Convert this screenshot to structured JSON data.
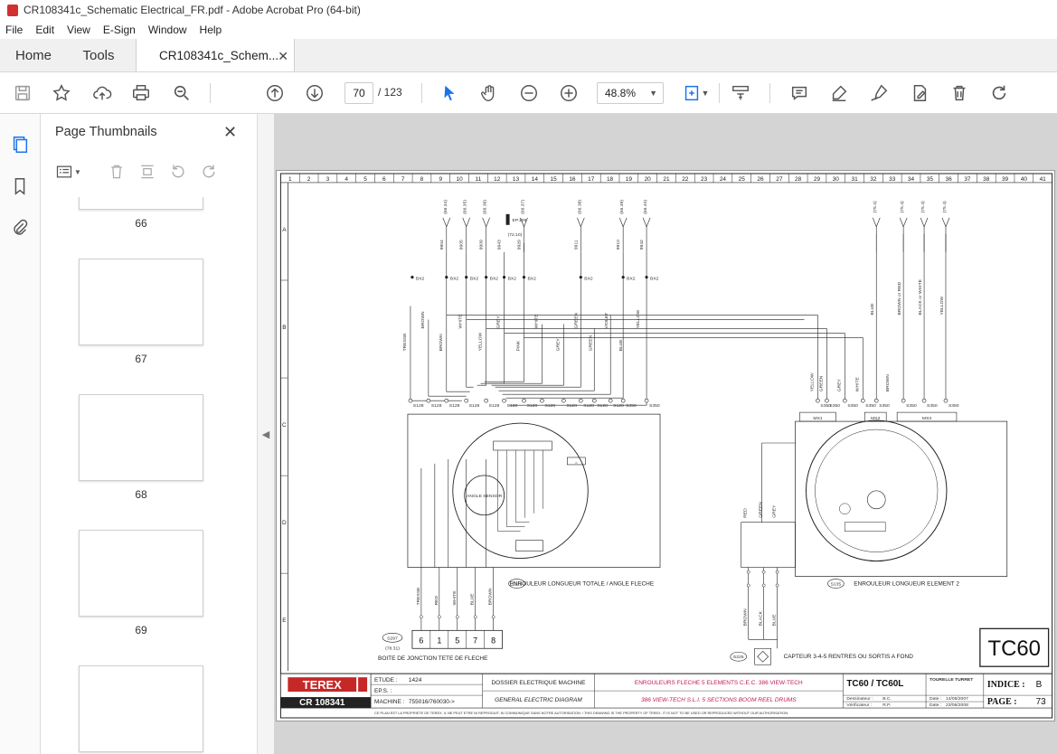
{
  "window": {
    "title": "CR108341c_Schematic Electrical_FR.pdf - Adobe Acrobat Pro (64-bit)"
  },
  "menu": [
    "File",
    "Edit",
    "View",
    "E-Sign",
    "Window",
    "Help"
  ],
  "tabs": {
    "home": "Home",
    "tools": "Tools",
    "document": "CR108341c_Schem..."
  },
  "toolbar": {
    "page_current": "70",
    "page_total": "/ 123",
    "zoom": "48.8%"
  },
  "thumbnails": {
    "title": "Page Thumbnails",
    "pages": [
      "66",
      "67",
      "68",
      "69"
    ]
  },
  "schematic": {
    "columns": [
      "1",
      "2",
      "3",
      "4",
      "5",
      "6",
      "7",
      "8",
      "9",
      "10",
      "11",
      "12",
      "13",
      "14",
      "15",
      "16",
      "17",
      "18",
      "19",
      "20",
      "21",
      "22",
      "23",
      "24",
      "25",
      "26",
      "27",
      "28",
      "29",
      "30",
      "31",
      "32",
      "33",
      "34",
      "35",
      "36",
      "37",
      "38",
      "39",
      "40",
      "41"
    ],
    "rows": [
      "A",
      "B",
      "C",
      "D",
      "E"
    ],
    "refs_top": [
      "(66.34)",
      "(66.35)",
      "(66.36)",
      "(66.37)",
      "(66.38)",
      "(66.39)",
      "(66.40)",
      "(75.4)",
      "(75.4)",
      "(75.4)",
      "(75.4)"
    ],
    "wire_numbers": [
      "9904",
      "9905",
      "9909",
      "9943",
      "9929",
      "9911",
      "9910",
      "9942"
    ],
    "connector_top": "BX2",
    "colors_left": [
      "TRESSE",
      "BROWN",
      "BROWN",
      "WHITE",
      "YELLOW",
      "GREY",
      "PINK",
      "WHITE",
      "GREY",
      "GREEN",
      "GREEN",
      "VIOLET",
      "BLUE",
      "YELLOW"
    ],
    "colors_right": [
      "YELLOW",
      "GREEN",
      "GREY",
      "WHITE",
      "BROWN",
      "BLUE",
      "BROWN or RED",
      "BLACK or WHITE",
      "YELLOW"
    ],
    "connector_s128": "S128",
    "connector_s350": "S350",
    "ms_labels": [
      "MS1",
      "MS2",
      "MS3"
    ],
    "angle_sensor": "ANGLE SENSOR",
    "reel1_caption": "ENROULEUR LONGUEUR TOTALE / ANGLE FLECHE",
    "reel1_ref": "S129",
    "reel2_caption": "ENROULEUR LONGUEUR ELEMENT 2",
    "reel2_ref": "S135",
    "capteur_caption": "CAPTEUR 3-4-5 RENTRES OU SORTIS A FOND",
    "capteur_ref": "S225",
    "boite_caption": "BOITE DE JONCTION TETE DE FLECHE",
    "boite_ref": "S297",
    "boite_sub": "(78.31)",
    "boite_terms": [
      "6",
      "1",
      "5",
      "7",
      "8"
    ],
    "boite_colors": [
      "TRESSE",
      "RED",
      "WHITE",
      "BLUE",
      "BROWN"
    ],
    "p900_colors_top": [
      "RED",
      "GREEN",
      "GREY"
    ],
    "p900_colors_bot": [
      "BROWN",
      "BLACK",
      "BLUE"
    ],
    "model_box": "TC60",
    "ep_ref": "EP.109",
    "ep_sub": "(72.10)",
    "title_block": {
      "brand": "TEREX",
      "doc_number": "CR 108341",
      "etude_label": "ETUDE :",
      "etude_value": "1424",
      "eps_label": "EP.S. :",
      "machine_label": "MACHINE :",
      "machine_value": "755016/760030->",
      "doc_fr": "DOSSIER ELECTRIQUE MACHINE",
      "doc_en": "GENERAL ELECTRIC DIAGRAM",
      "title_fr": "ENROULEURS FLECHE 5 ELEMENTS C.E.C. 386 VIEW-TECH",
      "title_en": "386 VIEW-TECH S.L.I. 5 SECTIONS BOOM REEL DRUMS",
      "model": "TC60 / TC60L",
      "section": "TOURELLE TURRET",
      "dessinateur_label": "Dessinateur :",
      "dessinateur_value": "B.C.",
      "verificateur_label": "Vérificateur :",
      "verificateur_value": "R.P.",
      "date_label": "Date :",
      "date1": "14/05/2007",
      "date2": "23/06/2008",
      "indice_label": "INDICE :",
      "indice_value": "B",
      "page_label": "PAGE :",
      "page_value": "73",
      "legal": "CE PLAN EST LA PROPRIETE DE TEREX. IL NE PEUT ETRE NI REPRODUIT, NI COMMUNIQUE SANS NOTRE AUTORISATION. / THIS DRAWING IS THE PROPERTY OF TEREX. IT IS NOT TO BE USED OR REPRODUCED WITHOUT OUR AUTHORISATION."
    }
  }
}
